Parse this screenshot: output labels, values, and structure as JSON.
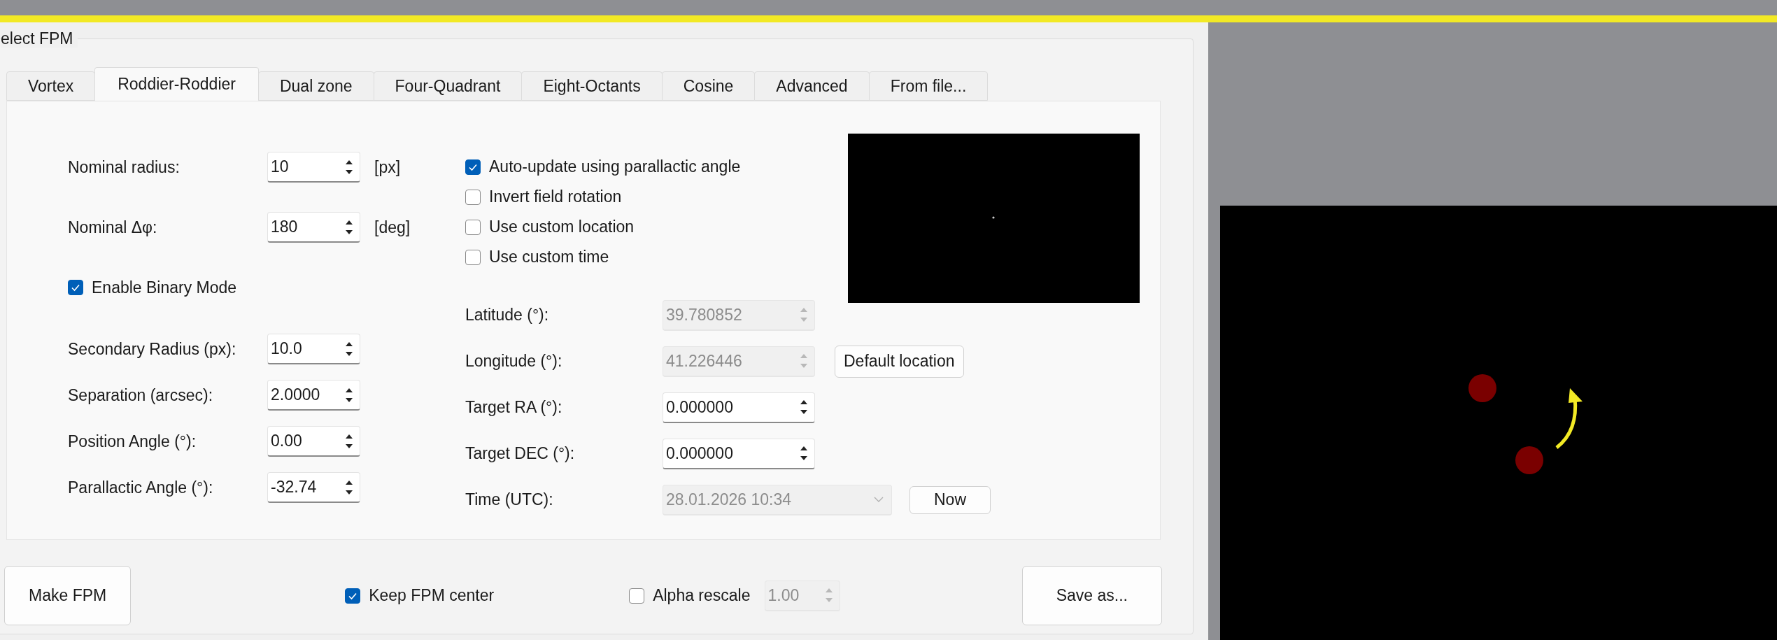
{
  "group_title": "elect FPM",
  "tabs": [
    {
      "label": "Vortex",
      "selected": false
    },
    {
      "label": "Roddier-Roddier",
      "selected": true
    },
    {
      "label": "Dual zone",
      "selected": false
    },
    {
      "label": "Four-Quadrant",
      "selected": false
    },
    {
      "label": "Eight-Octants",
      "selected": false
    },
    {
      "label": "Cosine",
      "selected": false
    },
    {
      "label": "Advanced",
      "selected": false
    },
    {
      "label": "From file...",
      "selected": false
    }
  ],
  "left_rows": [
    {
      "kind": "spin",
      "label": "Nominal radius:",
      "value": "10",
      "unit": "[px]"
    },
    {
      "kind": "spin",
      "label": "Nominal Δφ:",
      "value": "180",
      "unit": "[deg]"
    },
    {
      "kind": "checkbox",
      "label": "Enable Binary Mode",
      "checked": true
    },
    {
      "kind": "spin",
      "label": "Secondary Radius (px):",
      "value": "10.0"
    },
    {
      "kind": "spin",
      "label": "Separation (arcsec):",
      "value": "2.0000"
    },
    {
      "kind": "spin",
      "label": "Position Angle (°):",
      "value": "0.00"
    },
    {
      "kind": "spin",
      "label": "Parallactic Angle (°):",
      "value": "-32.74"
    }
  ],
  "options": [
    {
      "label": "Auto-update using parallactic angle",
      "checked": true
    },
    {
      "label": "Invert field rotation",
      "checked": false
    },
    {
      "label": "Use custom location",
      "checked": false
    },
    {
      "label": "Use custom time",
      "checked": false
    }
  ],
  "location_rows": [
    {
      "kind": "spin",
      "label": "Latitude (°):",
      "value": "39.780852",
      "disabled": true
    },
    {
      "kind": "spin",
      "label": "Longitude (°):",
      "value": "41.226446",
      "disabled": true,
      "button": "Default location"
    },
    {
      "kind": "spin",
      "label": "Target RA (°):",
      "value": "0.000000",
      "disabled": false
    },
    {
      "kind": "spin",
      "label": "Target DEC (°):",
      "value": "0.000000",
      "disabled": false
    },
    {
      "kind": "combo",
      "label": "Time (UTC):",
      "value": "28.01.2026 10:34",
      "disabled": true,
      "button": "Now"
    }
  ],
  "bottom": {
    "make_button": "Make FPM",
    "keep_center": {
      "label": "Keep FPM center",
      "checked": true
    },
    "alpha_rescale": {
      "label": "Alpha rescale",
      "checked": false,
      "value": "1.00",
      "disabled": true
    },
    "save_button": "Save as..."
  }
}
